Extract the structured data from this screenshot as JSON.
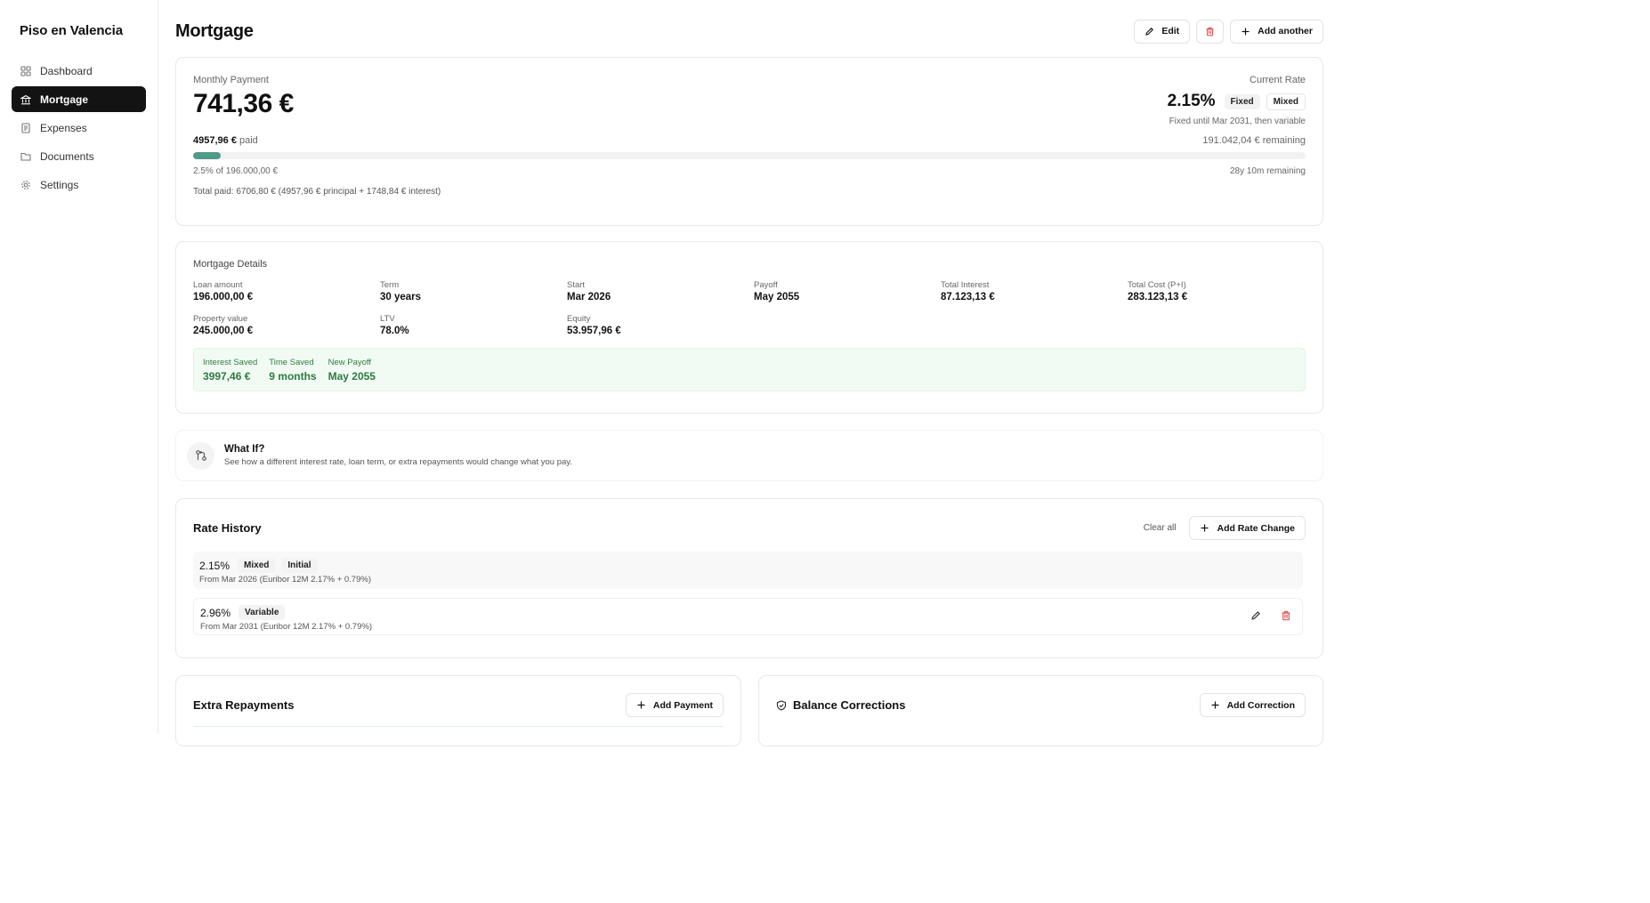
{
  "sidebar": {
    "brand": "Piso en Valencia",
    "items": [
      {
        "label": "Dashboard",
        "icon": "dashboard-icon"
      },
      {
        "label": "Mortgage",
        "icon": "bank-icon",
        "active": true
      },
      {
        "label": "Expenses",
        "icon": "receipt-icon"
      },
      {
        "label": "Documents",
        "icon": "folder-icon"
      },
      {
        "label": "Settings",
        "icon": "gear-icon"
      }
    ]
  },
  "header": {
    "title": "Mortgage",
    "edit_label": "Edit",
    "add_label": "Add another"
  },
  "summary": {
    "monthly_label": "Monthly Payment",
    "monthly_value": "741,36 €",
    "rate_label": "Current Rate",
    "rate_value": "2.15%",
    "tag_fixed": "Fixed",
    "tag_mixed": "Mixed",
    "rate_note": "Fixed until Mar 2031, then variable",
    "paid_amount": "4957,96 €",
    "paid_suffix": "paid",
    "remaining": "191.042,04 € remaining",
    "progress_fraction": 0.025,
    "progress_text": "2.5% of 196.000,00 €",
    "time_remaining": "28y 10m remaining",
    "total_paid": "Total paid: 6706,80 € (4957,96 € principal + 1748,84 € interest)"
  },
  "details": {
    "title": "Mortgage Details",
    "items": [
      {
        "label": "Loan amount",
        "value": "196.000,00 €"
      },
      {
        "label": "Term",
        "value": "30 years"
      },
      {
        "label": "Start",
        "value": "Mar 2026"
      },
      {
        "label": "Payoff",
        "value": "May 2055"
      },
      {
        "label": "Total Interest",
        "value": "87.123,13 €"
      },
      {
        "label": "Total Cost (P+I)",
        "value": "283.123,13 €"
      },
      {
        "label": "Property value",
        "value": "245.000,00 €"
      },
      {
        "label": "LTV",
        "value": "78.0%"
      },
      {
        "label": "Equity",
        "value": "53.957,96 €"
      }
    ],
    "savings": [
      {
        "label": "Interest Saved",
        "value": "3997,46 €"
      },
      {
        "label": "Time Saved",
        "value": "9 months"
      },
      {
        "label": "New Payoff",
        "value": "May 2055"
      }
    ]
  },
  "whatif": {
    "title": "What If?",
    "desc": "See how a different interest rate, loan term, or extra repayments would change what you pay."
  },
  "rate_history": {
    "title": "Rate History",
    "clear_label": "Clear all",
    "add_label": "Add Rate Change",
    "rows": [
      {
        "rate": "2.15%",
        "tags": [
          "Mixed",
          "Initial"
        ],
        "desc": "From Mar 2026 (Euribor 12M 2.17% + 0.79%)"
      },
      {
        "rate": "2.96%",
        "tags": [
          "Variable"
        ],
        "desc": "From Mar 2031 (Euribor 12M 2.17% + 0.79%)"
      }
    ]
  },
  "extra": {
    "title": "Extra Repayments",
    "add_label": "Add Payment"
  },
  "corrections": {
    "title": "Balance Corrections",
    "add_label": "Add Correction"
  },
  "colors": {
    "accent": "#131313",
    "progress": "#4f9a8a",
    "danger": "#e05252",
    "savings_green": "#2f7a3f"
  }
}
